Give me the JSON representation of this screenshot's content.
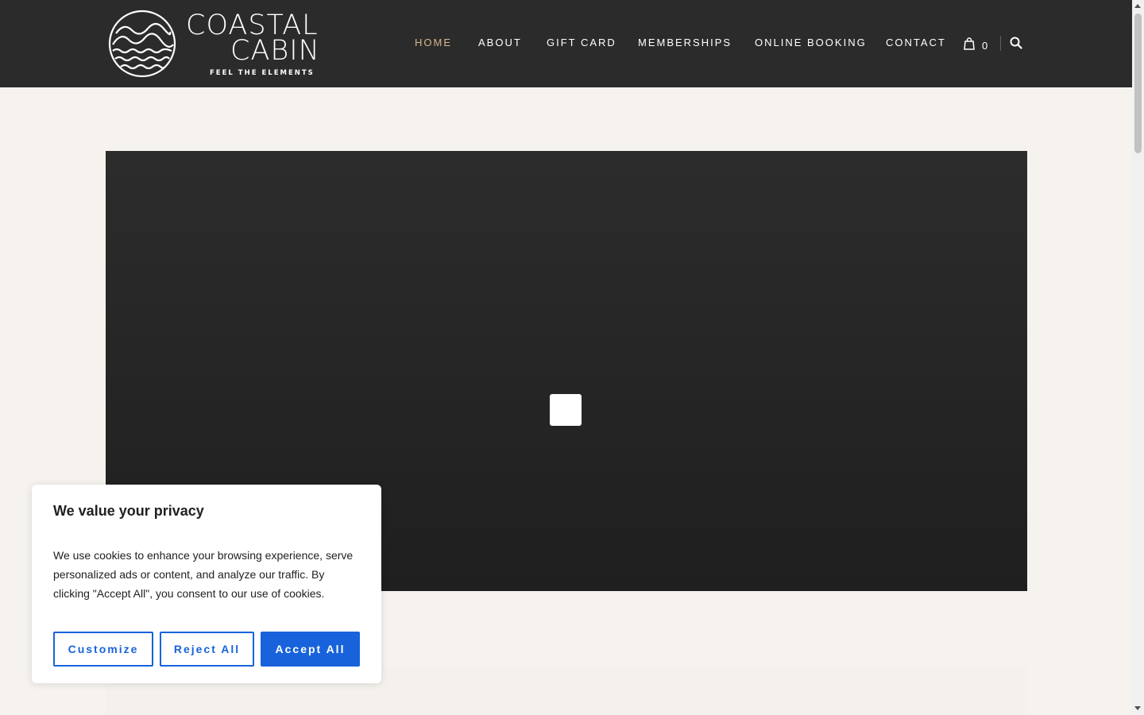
{
  "header": {
    "logo": {
      "line1": "COASTAL",
      "line2": "CABIN",
      "tagline": "FEEL THE ELEMENTS",
      "icon": "waves-circle-logo"
    },
    "nav": [
      {
        "label": "HOME",
        "active": true
      },
      {
        "label": "ABOUT",
        "active": false
      },
      {
        "label": "GIFT CARD",
        "active": false
      },
      {
        "label": "MEMBERSHIPS",
        "active": false
      },
      {
        "label": "ONLINE BOOKING",
        "active": false
      },
      {
        "label": "CONTACT",
        "active": false
      }
    ],
    "cart": {
      "icon": "shopping-bag-icon",
      "count": "0"
    },
    "search": {
      "icon": "search-icon"
    }
  },
  "hero": {
    "state": "loading video"
  },
  "cookie_banner": {
    "title": "We value your privacy",
    "body": "We use cookies to enhance your browsing experience, serve personalized ads or content, and analyze our traffic. By clicking \"Accept All\", you consent to our use of cookies.",
    "buttons": {
      "customize": "Customize",
      "reject": "Reject All",
      "accept": "Accept All"
    }
  },
  "colors": {
    "header_bg": "#2b2b2b",
    "page_bg": "#f6f3ef",
    "nav_active": "#d9b58a",
    "accent": "#1863dc"
  }
}
